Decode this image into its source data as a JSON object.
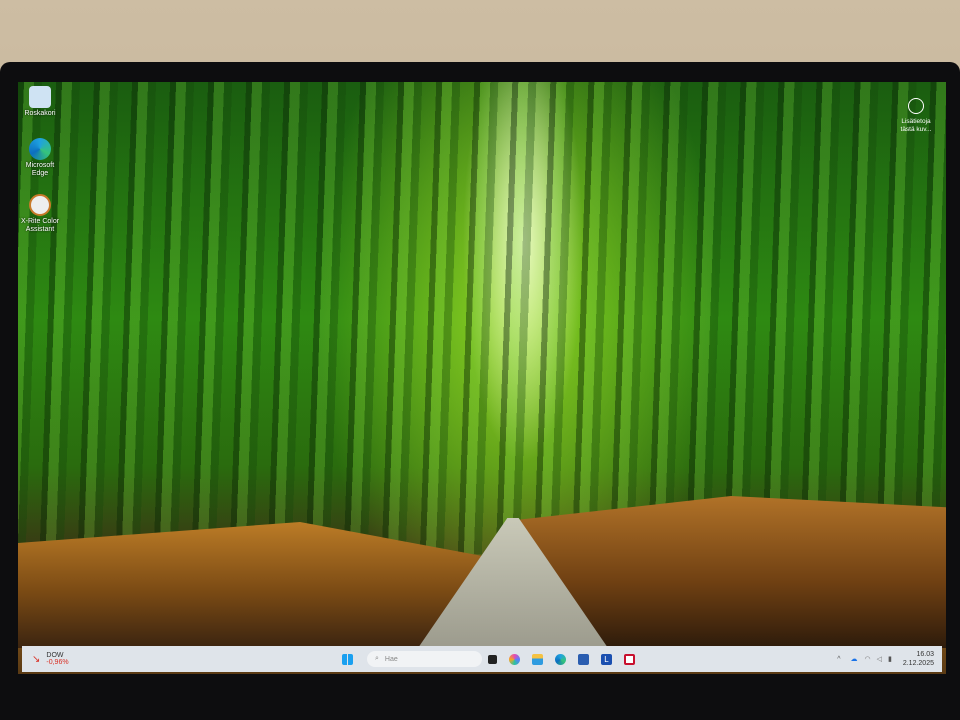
{
  "desktop_icons": [
    {
      "label": "Roskakori",
      "icon": "recycle-bin-icon"
    },
    {
      "label": "Microsoft Edge",
      "icon": "edge-icon"
    },
    {
      "label": "X-Rite Color Assistant",
      "icon": "xrite-icon"
    }
  ],
  "widget": {
    "label": "Lisätietoja tästä kuvasta",
    "display": "Lisätietoja tästä kuv..."
  },
  "taskbar": {
    "stock": {
      "name": "DOW",
      "change": "-0,96%",
      "color": "#d93025"
    },
    "search_placeholder": "Hae",
    "clock": {
      "time": "16.03",
      "date": "2.12.2025"
    }
  }
}
